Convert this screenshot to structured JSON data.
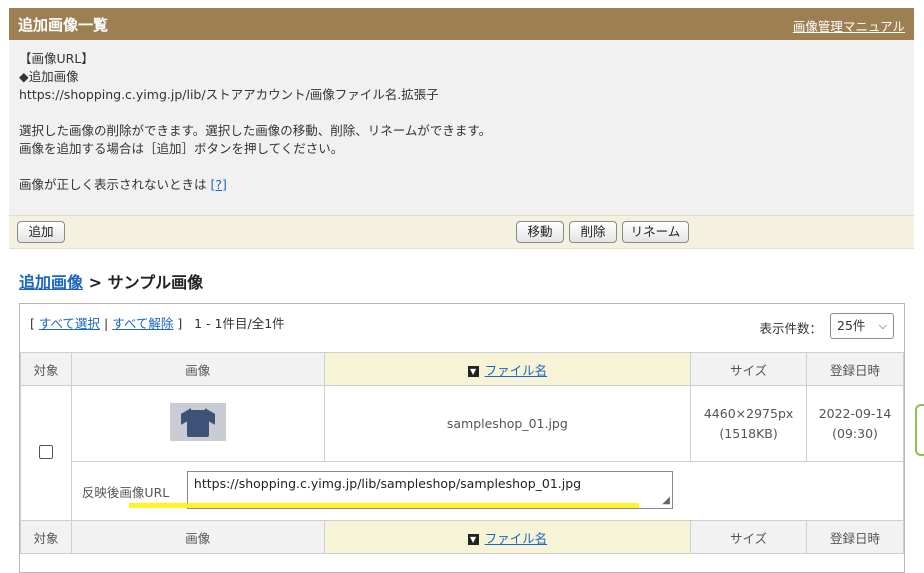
{
  "header": {
    "title": "追加画像一覧",
    "manual_link": "画像管理マニュアル"
  },
  "info": {
    "line1": "【画像URL】",
    "line2": "◆追加画像",
    "line3": "https://shopping.c.yimg.jp/lib/ストアアカウント/画像ファイル名.拡張子",
    "line4": "選択した画像の削除ができます。選択した画像の移動、削除、リネームができます。",
    "line5": "画像を追加する場合は［追加］ボタンを押してください。",
    "line6": "画像が正しく表示されないときは",
    "help_link": "[?]"
  },
  "toolbar": {
    "add": "追加",
    "move": "移動",
    "delete": "削除",
    "rename": "リネーム"
  },
  "breadcrumb": {
    "parent": "追加画像",
    "separator": ">",
    "current": "サンプル画像"
  },
  "selection": {
    "open_bracket": "[",
    "select_all": "すべて選択",
    "pipe": "|",
    "deselect_all": "すべて解除",
    "close_bracket": "]",
    "count": "1 - 1件目/全1件"
  },
  "per_page": {
    "label": "表示件数：",
    "value": "25件"
  },
  "table": {
    "headers": {
      "target": "対象",
      "image": "画像",
      "filename": "ファイル名",
      "size": "サイズ",
      "date": "登録日時"
    },
    "rows": [
      {
        "filename": "sampleshop_01.jpg",
        "dimensions": "4460×2975px",
        "filesize": "(1518KB)",
        "date": "2022-09-14",
        "time": "(09:30)",
        "url_label": "反映後画像URL",
        "url": "https://shopping.c.yimg.jp/lib/sampleshop/sampleshop_01.jpg"
      }
    ]
  },
  "colors": {
    "header_bg": "#9d7f52",
    "link": "#1a66c2",
    "highlight": "#fff200",
    "active_header": "#f7f3d6"
  }
}
